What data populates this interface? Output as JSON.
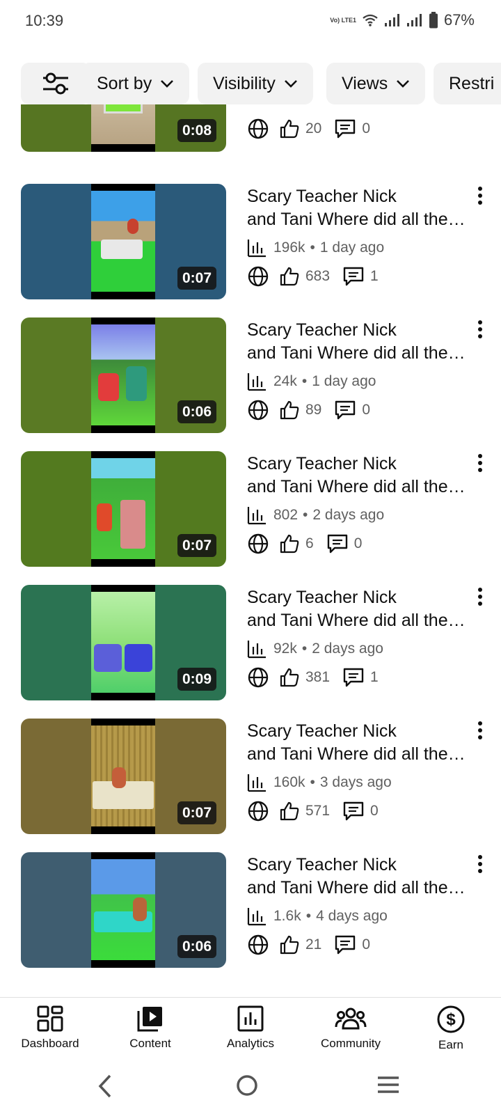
{
  "status": {
    "time": "10:39",
    "network": "Vo) LTE1",
    "battery": "67%"
  },
  "filters": {
    "sort_label": "Sort by",
    "visibility_label": "Visibility",
    "views_label": "Views",
    "restrictions_label": "Restri"
  },
  "videos": [
    {
      "title_line1": "",
      "title_line2": "",
      "views": "",
      "age": "",
      "likes": "20",
      "comments": "0",
      "duration": "0:08",
      "bg_color": "#567522"
    },
    {
      "title_line1": "Scary Teacher Nick",
      "title_line2": "and Tani Where did all the…",
      "views": "196k",
      "age": "1 day ago",
      "likes": "683",
      "comments": "1",
      "duration": "0:07",
      "bg_color": "#2b5a7a"
    },
    {
      "title_line1": "Scary Teacher Nick",
      "title_line2": "and Tani Where did all the…",
      "views": "24k",
      "age": "1 day ago",
      "likes": "89",
      "comments": "0",
      "duration": "0:06",
      "bg_color": "#5a7a24"
    },
    {
      "title_line1": "Scary Teacher Nick",
      "title_line2": "and Tani Where did all the…",
      "views": "802",
      "age": "2 days ago",
      "likes": "6",
      "comments": "0",
      "duration": "0:07",
      "bg_color": "#537a1f"
    },
    {
      "title_line1": "Scary Teacher Nick",
      "title_line2": "and Tani Where did all the…",
      "views": "92k",
      "age": "2 days ago",
      "likes": "381",
      "comments": "1",
      "duration": "0:09",
      "bg_color": "#2b7352"
    },
    {
      "title_line1": "Scary Teacher Nick",
      "title_line2": "and Tani Where did all the…",
      "views": "160k",
      "age": "3 days ago",
      "likes": "571",
      "comments": "0",
      "duration": "0:07",
      "bg_color": "#7a6a35"
    },
    {
      "title_line1": "Scary Teacher Nick",
      "title_line2": "and Tani Where did all the…",
      "views": "1.6k",
      "age": "4 days ago",
      "likes": "21",
      "comments": "0",
      "duration": "0:06",
      "bg_color": "#3f5d70"
    }
  ],
  "bottom_nav": {
    "dashboard": "Dashboard",
    "content": "Content",
    "analytics": "Analytics",
    "community": "Community",
    "earn": "Earn"
  }
}
